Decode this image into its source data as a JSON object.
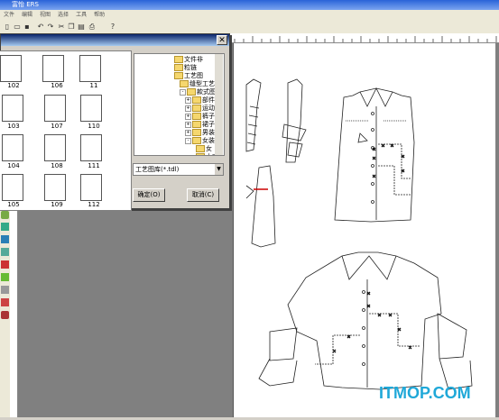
{
  "app": {
    "title": "富怡 ERS"
  },
  "menu": [
    "文件",
    "编辑",
    "视图",
    "选择",
    "工具",
    "帮助"
  ],
  "toolbar": [
    "new-icon",
    "open-icon",
    "save-icon",
    "undo-icon",
    "redo-icon",
    "cut-icon",
    "copy-icon",
    "paste-icon",
    "print-icon",
    "help-icon"
  ],
  "dialog": {
    "close": "✕",
    "thumb_labels": [
      "102",
      "106",
      "11",
      "103",
      "107",
      "110",
      "104",
      "108",
      "111",
      "105",
      "109",
      "112"
    ],
    "tree": [
      {
        "label": "文件非",
        "indent": 0
      },
      {
        "label": "粒链",
        "indent": 0
      },
      {
        "label": "工艺图",
        "indent": 0
      },
      {
        "label": "缝型工艺",
        "indent": 1
      },
      {
        "label": "款式图",
        "indent": 1
      },
      {
        "label": "部件",
        "indent": 2
      },
      {
        "label": "运动装",
        "indent": 2
      },
      {
        "label": "裤子",
        "indent": 2
      },
      {
        "label": "裙子",
        "indent": 2
      },
      {
        "label": "男装",
        "indent": 2
      },
      {
        "label": "女装",
        "indent": 2
      },
      {
        "label": "女",
        "indent": 3
      },
      {
        "label": "上衣",
        "indent": 3
      }
    ],
    "filetype": "工艺图库(*.tdl)",
    "ok": "确定(O)",
    "cancel": "取消(C)"
  },
  "watermark": "ITMOP.COM"
}
